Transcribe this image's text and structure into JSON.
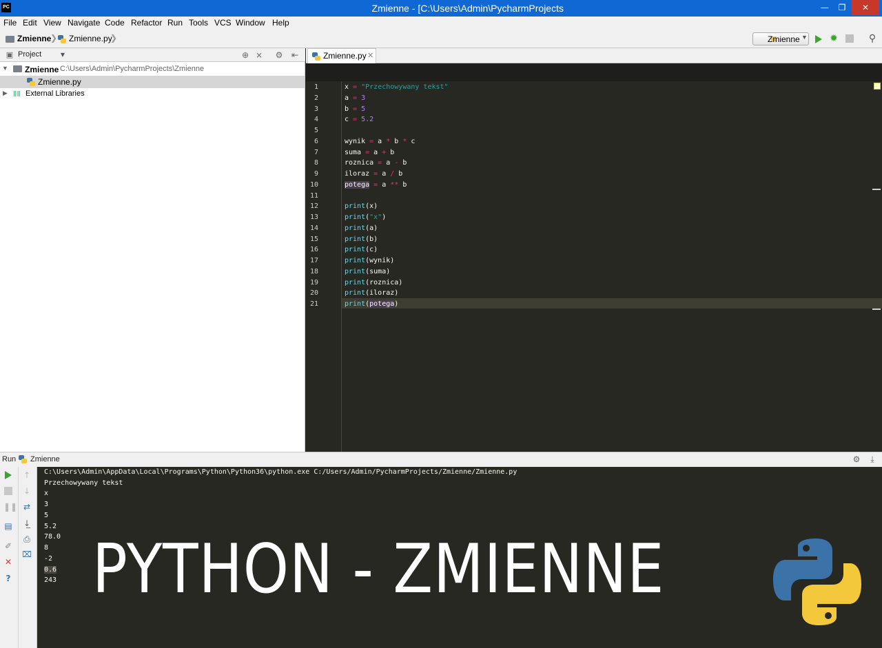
{
  "window": {
    "app_icon": "PC",
    "title": "Zmienne - [C:\\Users\\Admin\\PycharmProjects",
    "minimize": "—",
    "maximize": "❐",
    "close": "✕"
  },
  "menu": [
    "File",
    "Edit",
    "View",
    "Navigate",
    "Code",
    "Refactor",
    "Run",
    "Tools",
    "VCS",
    "Window",
    "Help"
  ],
  "breadcrumb": {
    "project": "Zmienne",
    "file": "Zmienne.py"
  },
  "toolbar": {
    "run_config": "Zmienne"
  },
  "project_panel": {
    "header": "Project",
    "root_name": "Zmienne",
    "root_path": "C:\\Users\\Admin\\PycharmProjects\\Zmienne",
    "file": "Zmienne.py",
    "external": "External Libraries"
  },
  "editor": {
    "tab": "Zmienne.py",
    "line_numbers": [
      "1",
      "2",
      "3",
      "4",
      "5",
      "6",
      "7",
      "8",
      "9",
      "10",
      "11",
      "12",
      "13",
      "14",
      "15",
      "16",
      "17",
      "18",
      "19",
      "20",
      "21"
    ],
    "code": [
      "x = \"Przechowywany tekst\"",
      "a = 3",
      "b = 5",
      "c = 5.2",
      "",
      "wynik = a * b * c",
      "suma = a + b",
      "roznica = a - b",
      "iloraz = a / b",
      "potega = a ** b",
      "",
      "print(x)",
      "print(\"x\")",
      "print(a)",
      "print(b)",
      "print(c)",
      "print(wynik)",
      "print(suma)",
      "print(roznica)",
      "print(iloraz)",
      "print(potega)"
    ]
  },
  "run_panel": {
    "label": "Run",
    "config": "Zmienne",
    "output": [
      "C:\\Users\\Admin\\AppData\\Local\\Programs\\Python\\Python36\\python.exe C:/Users/Admin/PycharmProjects/Zmienne/Zmienne.py",
      "Przechowywany tekst",
      "x",
      "3",
      "5",
      "5.2",
      "78.0",
      "8",
      "-2",
      "0.6",
      "243"
    ]
  },
  "overlay": {
    "title": "PYTHON - ZMIENNE"
  },
  "colors": {
    "titlebar": "#0f68d3",
    "editor_bg": "#272822",
    "close": "#c7372a",
    "python_blue": "#3b73a8",
    "python_yellow": "#f3c93b"
  }
}
